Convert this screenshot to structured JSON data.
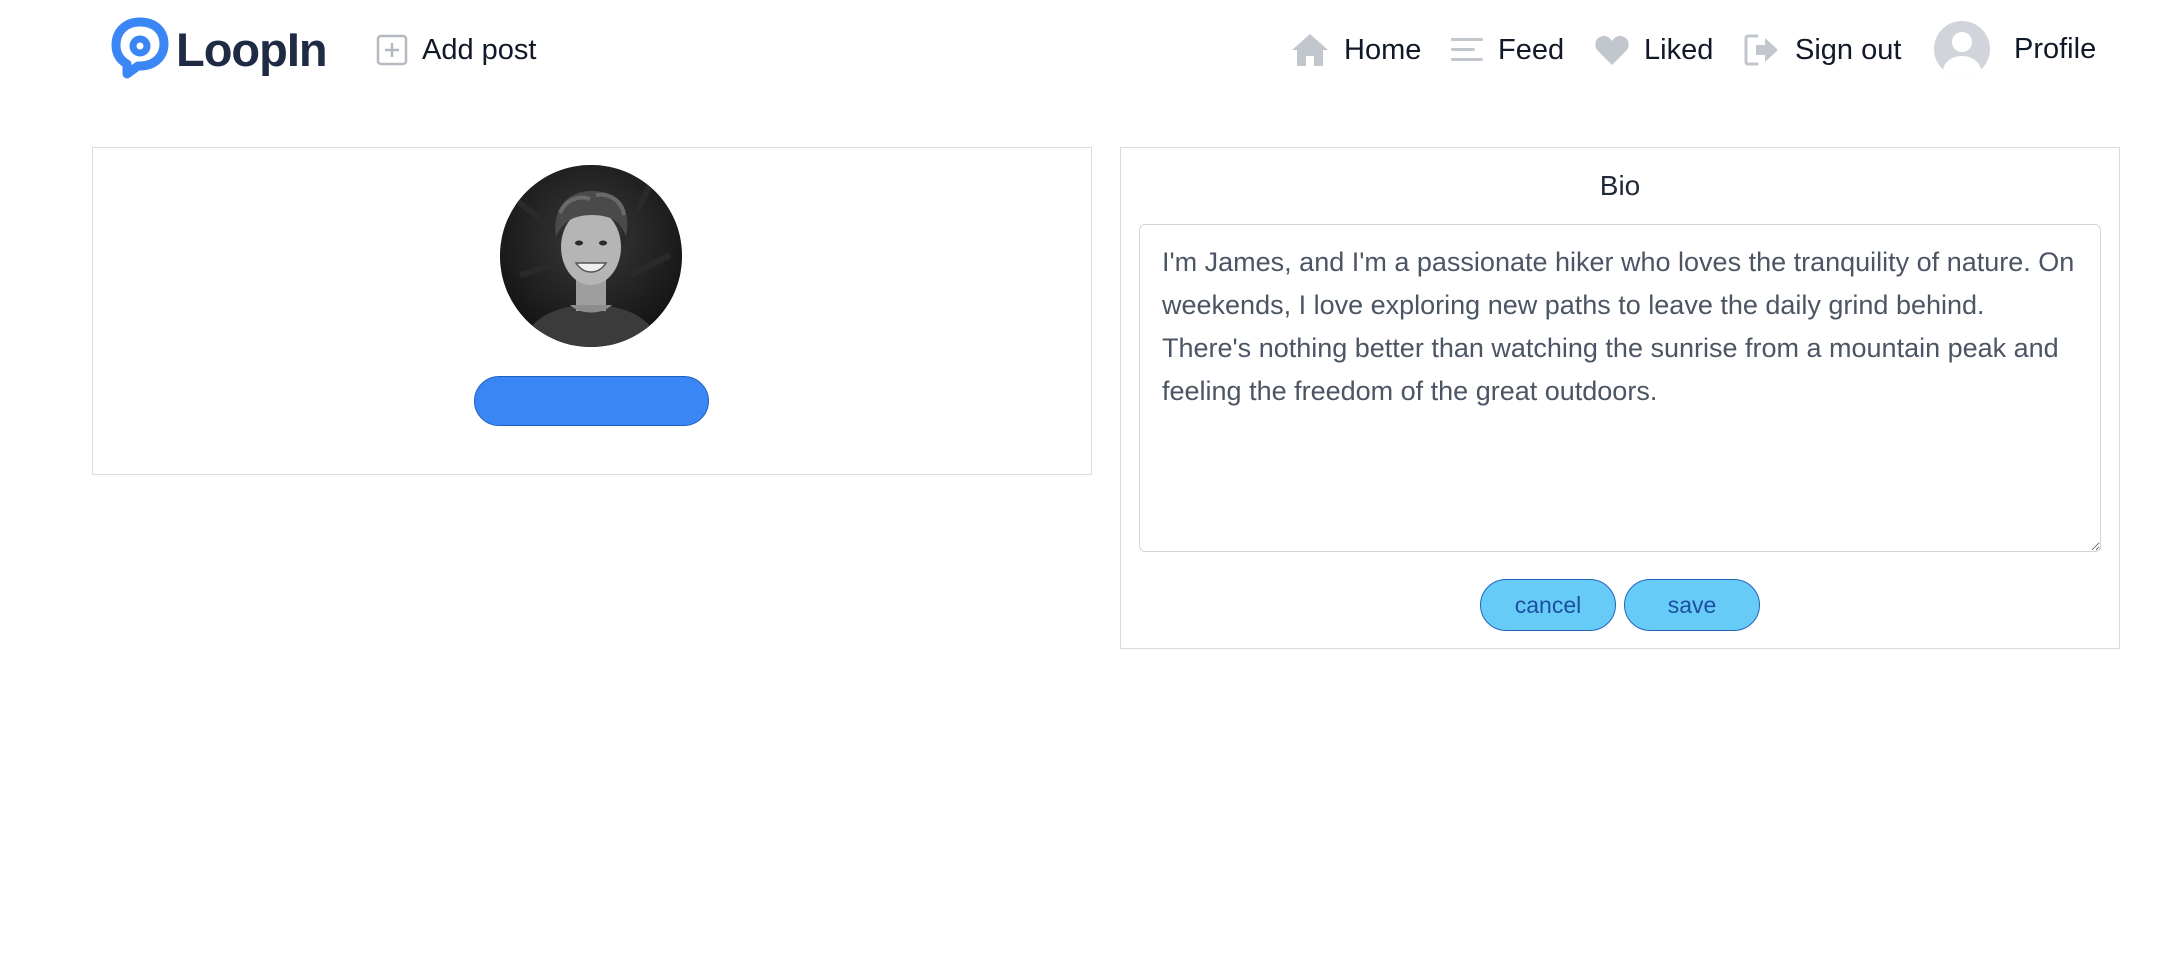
{
  "app": {
    "brand": "LoopIn",
    "brand_color": "#3b86f5"
  },
  "nav": {
    "add_post": "Add post",
    "home": "Home",
    "feed": "Feed",
    "liked": "Liked",
    "sign_out": "Sign out",
    "profile": "Profile",
    "icons": [
      "plus-square-icon",
      "home-icon",
      "feed-lines-icon",
      "heart-icon",
      "sign-out-icon",
      "user-avatar-icon"
    ]
  },
  "profile_card": {
    "photo": "profile-photo",
    "upload_button_label": ""
  },
  "bio_card": {
    "title": "Bio",
    "text": "I'm James, and I'm a passionate hiker who loves the tranquility of nature. On weekends, I love exploring new paths to leave the daily grind behind. There's nothing better than watching the sunrise from a mountain peak and feeling the freedom of the great outdoors.",
    "cancel_label": "cancel",
    "save_label": "save"
  }
}
